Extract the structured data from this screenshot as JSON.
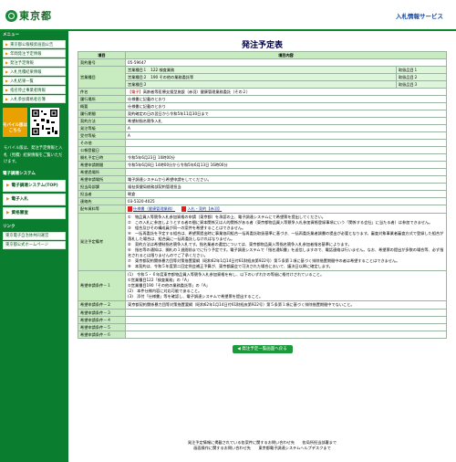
{
  "header": {
    "logo_text": "東京都",
    "service_link": "入札情報サービス"
  },
  "sidebar": {
    "menu_title": "メニュー",
    "items": [
      "東京都公報検索画面公告",
      "年間発注予定情報",
      "発注予定情報",
      "入札見積結果情報",
      "入札結果一覧",
      "指名停止事業者情報",
      "入札参加資格者名簿"
    ],
    "mobile_badge": "モバイル版はこちら",
    "mobile_note": "モバイル版は、発注予定情報と入札（見積）結果情報をご覧いただけます。",
    "system_title": "電子調達システム",
    "buttons": [
      "電子調達システム(TOP)",
      "電子入札",
      "資格審査"
    ],
    "links_title": "リンク",
    "links": [
      "東京電子自治体共同運営",
      "東京都公式ホームページ"
    ]
  },
  "main": {
    "title": "発注予定表",
    "col_item": "項目",
    "col_content": "項目内容",
    "rows": [
      {
        "label": "契約番号",
        "value": "05-59647"
      },
      {
        "label": "営業種目",
        "subrows": [
          {
            "left": "営業種目１",
            "value": "122 検査業務",
            "right": "取扱品目１"
          },
          {
            "left": "営業種目２",
            "value": "190 その他の業務委託等",
            "right": "取扱品目２"
          },
          {
            "left": "営業種目３",
            "value": "",
            "right": "取扱品目３"
          }
        ]
      },
      {
        "label": "件名",
        "tag": "【電子】",
        "value": "高齢者等医療支援型施設（赤羽）健康管理業務委託（その２）"
      },
      {
        "label": "履行場所",
        "value": "仕様書に記載のとおり"
      },
      {
        "label": "概要",
        "value": "仕様書に記載のとおり"
      },
      {
        "label": "履行期間",
        "value": "契約確定の日の翌日から令和5年11月30日まで"
      },
      {
        "label": "契約方法",
        "value": "希望制指名競争入札"
      },
      {
        "label": "発注等級",
        "value": "A"
      },
      {
        "label": "受付等級",
        "value": "A"
      },
      {
        "label": "その他",
        "value": ""
      },
      {
        "label": "公報登載日",
        "value": ""
      },
      {
        "label": "開札予定日時",
        "value": "令和5年6月23日 10時00分"
      },
      {
        "label": "希望申請期間",
        "value": "令和5年6月8日 14時00分から令和5年6月13日 16時00分"
      },
      {
        "label": "希望過場所",
        "value": ""
      },
      {
        "label": "希望申請場所",
        "value": "電子調達システムから希望申請をしてください。"
      },
      {
        "label": "担当局部課",
        "value": "福祉保健局総務部契約管理担当"
      },
      {
        "label": "担当者",
        "value": "朝倉"
      },
      {
        "label": "連絡先",
        "value": "03-5320-4025"
      }
    ],
    "docs_label": "配布資料等",
    "docs": [
      "仕様書（健康管理業務）",
      "入札・契約【赤羽】"
    ],
    "remarks_label": "発注予定備考",
    "remarks": [
      "①　物品買入等競争入札参加資格の申請（東京都）を承認の上、電子調達システムにて希望票を提出してください。",
      "②　この入札に参加しようとする者の間に資本関係又は人的関係がある者（東京都物品買入等競争入札参加資格登録事項にいう「関係する会社」に当たる者）は参加できません。",
      "③　組合及びその構成員が同一の案件を希望することはできません。",
      "④　一括再委託を予定する組合は、希望票提出時に事業協同組合一括再委託取扱基準に基づき、一括再委託業者調書の提出が必要となります。審査対象事業者審査方式で登録した組合が落札した場合は、組合員に一括再委託しなければなりません。",
      "⑤　契約方法は希望制指名競争入札です。指名業者の選定については、東京都物品買入等指名競争入札参加者指名基準によります。",
      "⑥　指名等の通知は、開札の１週間前までに行う予定です。電子調達システムで「指名通知書」を送信しますので、電話連絡は行いません。なお、希望票の提出が多数の場合等、必ず指名されるとは限りませんのでご了承ください。",
      "⑦　東京都契約関係暴力団等対策措置要綱（昭和62年1月14日付61財経庶第922号）第５条第１項に基づく排除措置期間中の者は希望することはできません。",
      "⑧　本契約は、令和５年度第二回定例会補正予算が、東京都議会で可決された場合において、議決日以降に確定します。"
    ],
    "cond1_label": "希望申請条件－１",
    "cond1": [
      "(1)　令和５・６年度東京都物品買入等競争入札参加資格を有し、以下のいずれかの等級に格付けされていること。",
      "①営業種目122「検査業務」の「A」",
      "②営業種目190「その他の業務委託等」の「A」",
      "(2)　本件仕様内容に対応可能であること。",
      "(3)　添付「仕様書」等を確認し、電子調達システムで希望票を提出すること。"
    ],
    "cond2_label": "希望申請条件－２",
    "cond2": "東京都契約関係暴力団等対策措置要綱（昭和62年1月14日付61財経庶第922号）第５条第１項に基づく排除措置期間中でないこと。",
    "cond_more": [
      "希望申請条件－３",
      "希望申請条件－４",
      "希望申請条件－５",
      "希望申請条件－６"
    ],
    "back_button": "発注予定一覧画面へ戻る"
  },
  "footer": {
    "line1": "発注予定情報に掲載されている各案件に関するお問い合わせ先　　各局所担当部署まで",
    "line2": "画面操作に関するお問い合わせ先　　東京都電子調達システムヘルプデスクまで"
  }
}
